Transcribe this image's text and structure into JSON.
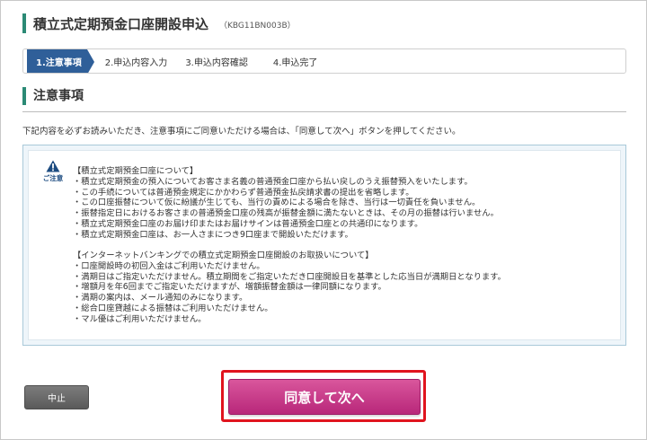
{
  "header": {
    "title": "積立式定期預金口座開設申込",
    "code": "（KBG11BN003B）"
  },
  "steps": [
    {
      "label": "1.注意事項",
      "active": true
    },
    {
      "label": "2.申込内容入力",
      "active": false
    },
    {
      "label": "3.申込内容確認",
      "active": false
    },
    {
      "label": "4.申込完了",
      "active": false
    }
  ],
  "section": {
    "title": "注意事項"
  },
  "intro": "下記内容を必ずお読みいただき、注意事項にご同意いただける場合は、「同意して次へ」ボタンを押してください。",
  "notice": {
    "icon_label": "ご注意",
    "group1": [
      "【積立式定期預金口座について】",
      "・積立式定期預金の預入についてお客さま名義の普通預金口座から払い戻しのうえ振替預入をいたします。",
      "・この手続については普通預金規定にかかわらず普通預金払戻請求書の提出を省略します。",
      "・この口座振替について仮に紛議が生じても、当行の責めによる場合を除き、当行は一切責任を負いません。",
      "・振替指定日におけるお客さまの普通預金口座の残高が振替金額に満たないときは、その月の振替は行いません。",
      "・積立式定期預金口座のお届け印またはお届けサインは普通預金口座との共通印になります。",
      "・積立式定期預金口座は、お一人さまにつき9口座まで開設いただけます。"
    ],
    "group2": [
      "【インターネットバンキングでの積立式定期預金口座開設のお取扱いについて】",
      "・口座開設時の初回入金はご利用いただけません。",
      "・満期日はご指定いただけません。積立期間をご指定いただき口座開設日を基準とした応当日が満期日となります。",
      "・増額月を年6回までご指定いただけますが、増額振替金額は一律同額になります。",
      "・満期の案内は、メール通知のみになります。",
      "・総合口座貸越による振替はご利用いただけません。",
      "・マル優はご利用いただけません。"
    ]
  },
  "buttons": {
    "cancel": "中止",
    "agree": "同意して次へ"
  },
  "colors": {
    "accent_green": "#2b8a75",
    "step_active": "#2f5f99",
    "agree_button": "#c73a8a",
    "highlight_border": "#e0141e"
  }
}
